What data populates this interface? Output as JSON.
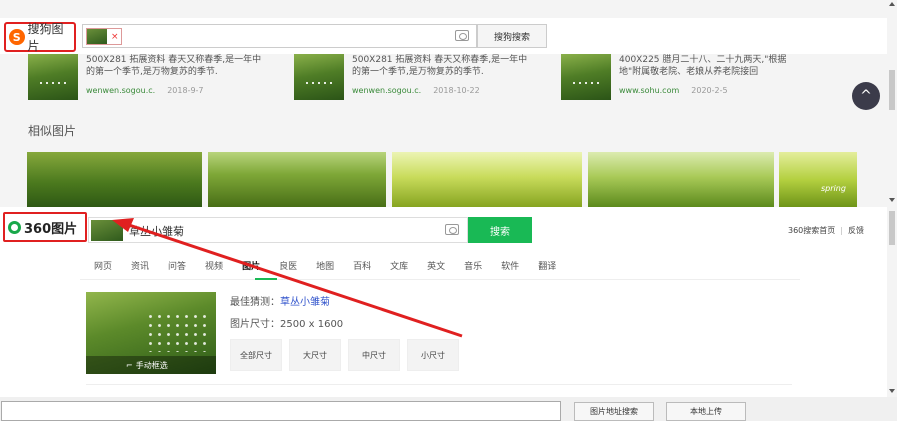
{
  "sogou": {
    "logo_text": "搜狗图片",
    "logo_letter": "S",
    "search_button": "搜狗搜索",
    "chip_close": "×",
    "results": [
      {
        "desc": "500X281 拓展资料 春天又称春季,是一年中的第一个季节,是万物复苏的季节.",
        "source": "wenwen.sogou.c.",
        "date": "2018-9-7"
      },
      {
        "desc": "500X281 拓展资料 春天又称春季,是一年中的第一个季节,是万物复苏的季节.",
        "source": "wenwen.sogou.c.",
        "date": "2018-10-22"
      },
      {
        "desc": "400X225 腊月二十八、二十九两天,\"根据地\"附属敬老院、老娘从养老院接回",
        "source": "www.sohu.com",
        "date": "2020-2-5"
      }
    ],
    "back_to_top": "^",
    "similar_title": "相似图片",
    "similar_overlay": "spring"
  },
  "p360": {
    "logo_text": "360图片",
    "search_value": "草丛小雏菊",
    "search_button": "搜索",
    "toplinks": [
      "360搜索首页",
      "反馈"
    ],
    "nav": [
      "网页",
      "资讯",
      "问答",
      "视频",
      "图片",
      "良医",
      "地图",
      "百科",
      "文库",
      "英文",
      "音乐",
      "软件",
      "翻译"
    ],
    "caption": "手动框选",
    "guess_label": "最佳猜测：",
    "guess_value": "草丛小雏菊",
    "size_text": "图片尺寸：2500 x 1600",
    "size_buttons": [
      "全部尺寸",
      "大尺寸",
      "中尺寸",
      "小尺寸"
    ]
  },
  "footer": {
    "url_search": "图片地址搜索",
    "local_upload": "本地上传"
  },
  "colors": {
    "annotation": "#e02020",
    "green": "#19b955"
  }
}
